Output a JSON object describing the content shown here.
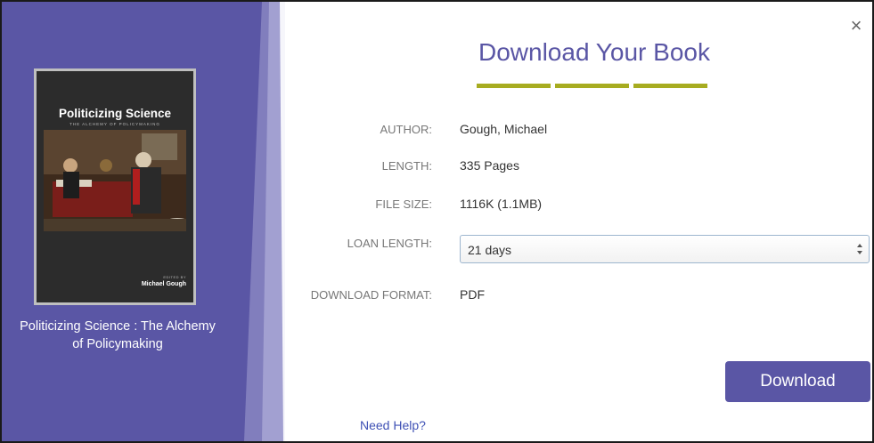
{
  "book": {
    "cover_title": "Politicizing Science",
    "cover_subtitle": "THE ALCHEMY OF POLICYMAKING",
    "cover_edited_by": "EDITED BY",
    "cover_editor": "Michael Gough",
    "caption": "Politicizing Science : The Alchemy of Policymaking"
  },
  "dialog": {
    "title": "Download Your Book",
    "close_label": "×",
    "accent_color": "#a7ac20",
    "brand_color": "#5a56a5"
  },
  "details": {
    "author_label": "AUTHOR:",
    "author_value": "Gough, Michael",
    "length_label": "LENGTH:",
    "length_value": "335 Pages",
    "filesize_label": "FILE SIZE:",
    "filesize_value": "1116K (1.1MB)",
    "loan_label": "LOAN LENGTH:",
    "loan_value": "21 days",
    "format_label": "DOWNLOAD FORMAT:",
    "format_value": "PDF"
  },
  "actions": {
    "download_label": "Download",
    "help_label": "Need Help?"
  }
}
